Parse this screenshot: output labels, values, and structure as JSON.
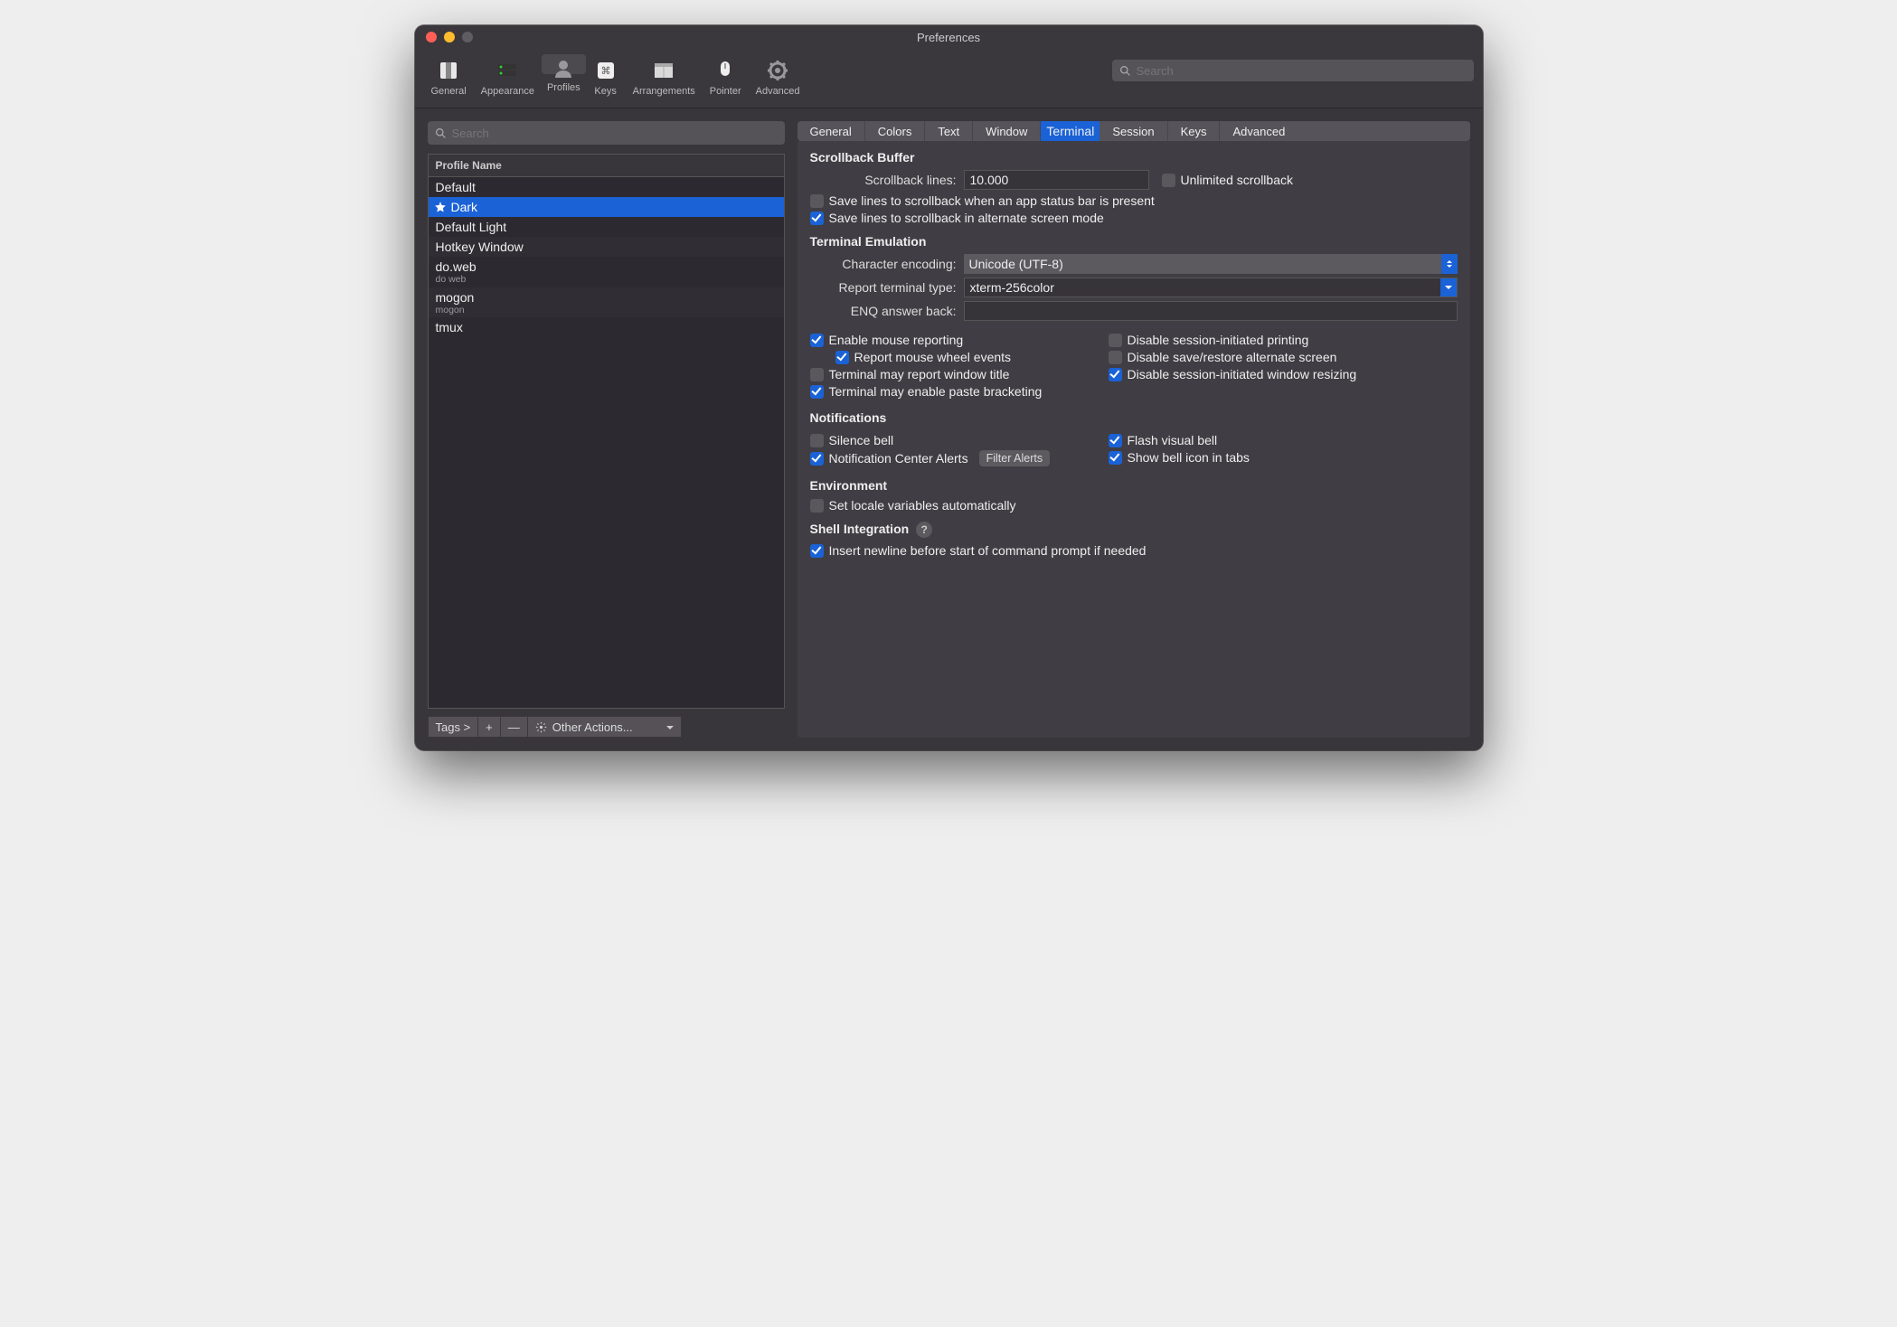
{
  "window": {
    "title": "Preferences"
  },
  "toolbar": {
    "items": [
      "General",
      "Appearance",
      "Profiles",
      "Keys",
      "Arrangements",
      "Pointer",
      "Advanced"
    ],
    "selected": 2,
    "search_placeholder": "Search"
  },
  "sidebar": {
    "search_placeholder": "Search",
    "header": "Profile Name",
    "profiles": [
      {
        "name": "Default",
        "default": false,
        "selected": false
      },
      {
        "name": "Dark",
        "default": true,
        "selected": true
      },
      {
        "name": "Default Light",
        "default": false,
        "selected": false
      },
      {
        "name": "Hotkey Window",
        "default": false,
        "selected": false
      },
      {
        "name": "do.web",
        "sub": "do web",
        "default": false,
        "selected": false
      },
      {
        "name": "mogon",
        "sub": "mogon",
        "default": false,
        "selected": false
      },
      {
        "name": "tmux",
        "default": false,
        "selected": false
      }
    ],
    "footer": {
      "tags": "Tags >",
      "add": "+",
      "remove": "—",
      "other": "Other Actions..."
    }
  },
  "tabs": {
    "items": [
      "General",
      "Colors",
      "Text",
      "Window",
      "Terminal",
      "Session",
      "Keys",
      "Advanced"
    ],
    "selected": 4
  },
  "scrollback": {
    "heading": "Scrollback Buffer",
    "lines_label": "Scrollback lines:",
    "lines_value": "10.000",
    "unlimited_label": "Unlimited scrollback",
    "unlimited_checked": false,
    "save_status_label": "Save lines to scrollback when an app status bar is present",
    "save_status_checked": false,
    "save_alt_label": "Save lines to scrollback in alternate screen mode",
    "save_alt_checked": true
  },
  "emulation": {
    "heading": "Terminal Emulation",
    "encoding_label": "Character encoding:",
    "encoding_value": "Unicode (UTF-8)",
    "report_type_label": "Report terminal type:",
    "report_type_value": "xterm-256color",
    "enq_label": "ENQ answer back:",
    "enq_value": "",
    "left": {
      "mouse_reporting": {
        "label": "Enable mouse reporting",
        "checked": true
      },
      "mouse_wheel": {
        "label": "Report mouse wheel events",
        "checked": true
      },
      "report_title": {
        "label": "Terminal may report window title",
        "checked": false
      },
      "paste_bracket": {
        "label": "Terminal may enable paste bracketing",
        "checked": true
      }
    },
    "right": {
      "disable_print": {
        "label": "Disable session-initiated printing",
        "checked": false
      },
      "disable_altscr": {
        "label": "Disable save/restore alternate screen",
        "checked": false
      },
      "disable_resize": {
        "label": "Disable session-initiated window resizing",
        "checked": true
      }
    }
  },
  "notifications": {
    "heading": "Notifications",
    "silence_bell": {
      "label": "Silence bell",
      "checked": false
    },
    "nc_alerts": {
      "label": "Notification Center Alerts",
      "checked": true,
      "button": "Filter Alerts"
    },
    "flash_bell": {
      "label": "Flash visual bell",
      "checked": true
    },
    "bell_icon": {
      "label": "Show bell icon in tabs",
      "checked": true
    }
  },
  "environment": {
    "heading": "Environment",
    "locale": {
      "label": "Set locale variables automatically",
      "checked": false
    }
  },
  "shell": {
    "heading": "Shell Integration",
    "newline": {
      "label": "Insert newline before start of command prompt if needed",
      "checked": true
    }
  }
}
